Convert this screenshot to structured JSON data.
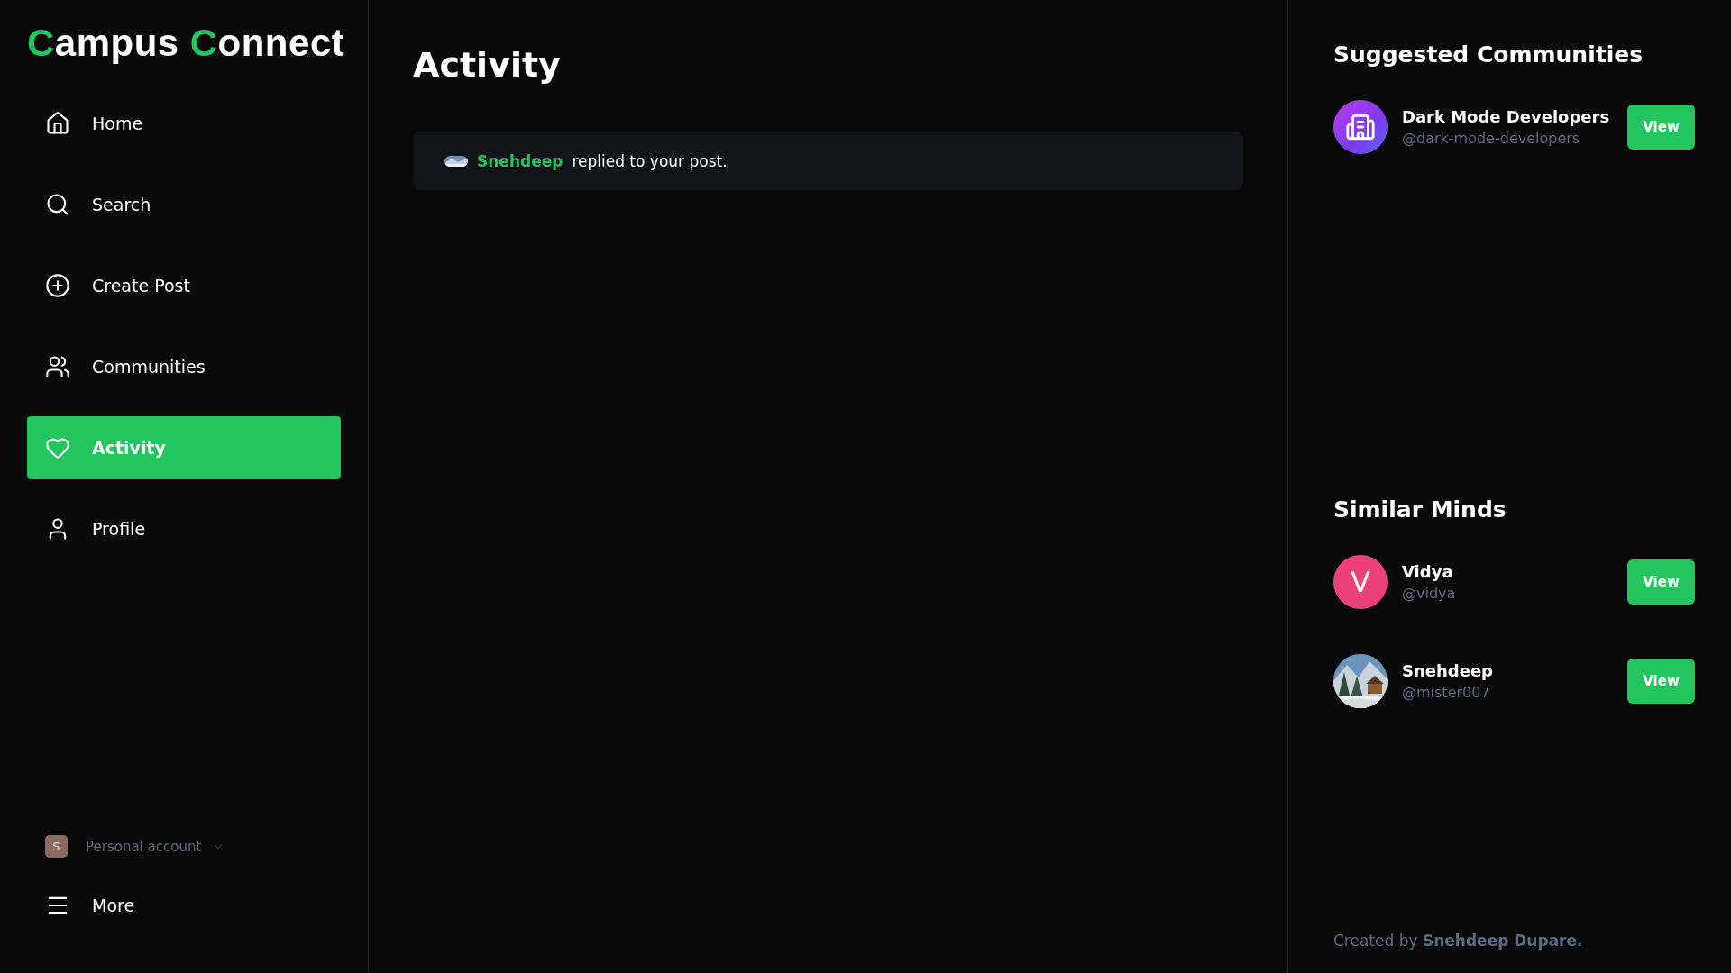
{
  "logo": [
    {
      "initial": "C",
      "rest": "ampus"
    },
    {
      "initial": "C",
      "rest": "onnect"
    }
  ],
  "nav": [
    {
      "kind": "home",
      "label": "Home",
      "selected": false
    },
    {
      "kind": "search",
      "label": "Search",
      "selected": false
    },
    {
      "kind": "create",
      "label": "Create Post",
      "selected": false
    },
    {
      "kind": "communities",
      "label": "Communities",
      "selected": false
    },
    {
      "kind": "activity",
      "label": "Activity",
      "selected": true
    },
    {
      "kind": "profile",
      "label": "Profile",
      "selected": false
    }
  ],
  "account": {
    "badge": "S",
    "label": "Personal account"
  },
  "more": {
    "label": "More"
  },
  "main": {
    "title": "Activity",
    "notifications": [
      {
        "author": "Snehdeep",
        "text": "replied to your post."
      }
    ]
  },
  "suggested": {
    "title": "Suggested Communities",
    "items": [
      {
        "kind": "icon",
        "name": "Dark Mode Developers",
        "handle": "@dark-mode-developers",
        "button": "View"
      }
    ]
  },
  "similar": {
    "title": "Similar Minds",
    "items": [
      {
        "kind": "letter",
        "letter": "V",
        "name": "Vidya",
        "handle": "@vidya",
        "button": "View"
      },
      {
        "kind": "picture",
        "name": "Snehdeep",
        "handle": "@mister007",
        "button": "View"
      }
    ]
  },
  "footer": {
    "prefix": "Created by",
    "author": "Snehdeep Dupare."
  }
}
